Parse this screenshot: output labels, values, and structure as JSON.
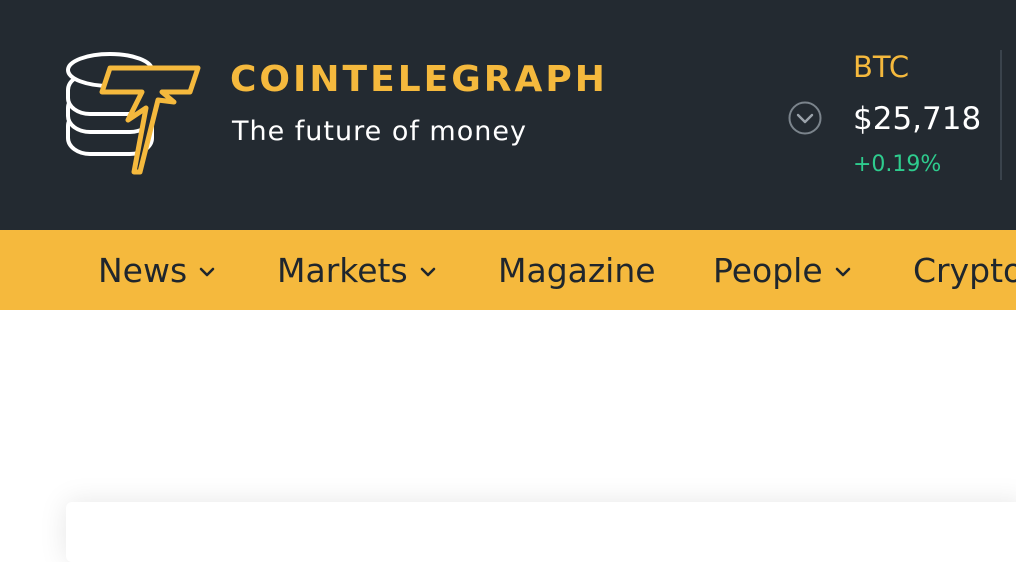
{
  "brand": {
    "name": "COINTELEGRAPH",
    "tagline": "The future of money",
    "primary_color": "#f5b93d",
    "header_bg": "#232a31"
  },
  "ticker": {
    "toggle_icon": "chevron-down-circle-icon",
    "symbol": "BTC",
    "price": "$25,718",
    "change": "+0.19%",
    "change_color": "#2ecc8e"
  },
  "nav": {
    "items": [
      {
        "label": "News",
        "has_dropdown": true
      },
      {
        "label": "Markets",
        "has_dropdown": true
      },
      {
        "label": "Magazine",
        "has_dropdown": false
      },
      {
        "label": "People",
        "has_dropdown": true
      },
      {
        "label": "Crypto",
        "has_dropdown": false
      }
    ]
  }
}
